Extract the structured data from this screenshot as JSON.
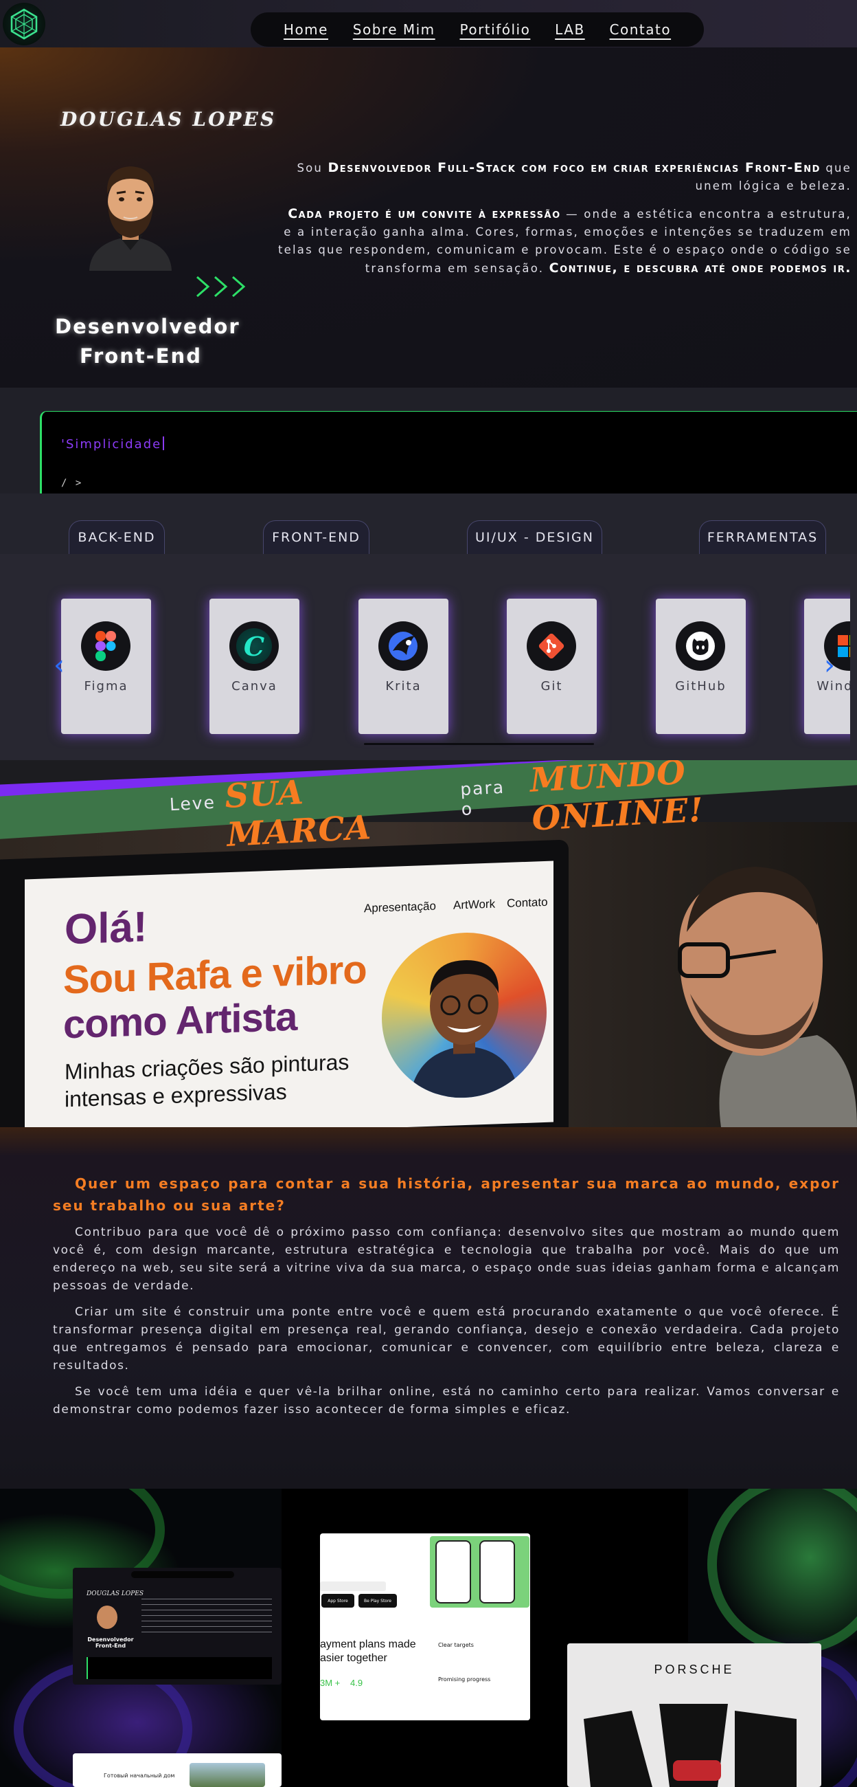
{
  "nav": {
    "items": [
      "Home",
      "Sobre Mim",
      "Portifólio",
      "LAB",
      "Contato"
    ]
  },
  "hero": {
    "name": "DOUGLAS LOPES",
    "role_line1": "Desenvolvedor",
    "role_line2": "Front-End",
    "p1_a": "Sou",
    "p1_strong": "Desenvolvedor Full-Stack com foco em criar experiências Front-End",
    "p1_b": "que unem lógica e beleza.",
    "p2_strong": "Cada projeto é um convite à expressão",
    "p2_a": "— onde a estética encontra a estrutura, e a interação ganha alma. Cores, formas, emoções e intenções se traduzem em telas que respondem, comunicam e provocam. Este é o espaço onde o código se transforma em sensação.",
    "p2_strong2": "Continue, e descubra até onde podemos ir."
  },
  "terminal": {
    "typed": "'Simplicidade",
    "prompt": "/ >"
  },
  "tabs": [
    "BACK-END",
    "FRONT-END",
    "UI/UX - DESIGN",
    "FERRAMENTAS"
  ],
  "tools": [
    {
      "label": "Figma",
      "icon": "figma-icon"
    },
    {
      "label": "Canva",
      "icon": "canva-icon"
    },
    {
      "label": "Krita",
      "icon": "krita-icon"
    },
    {
      "label": "Git",
      "icon": "git-icon"
    },
    {
      "label": "GitHub",
      "icon": "github-icon"
    },
    {
      "label": "Windows",
      "icon": "windows-icon"
    }
  ],
  "carousel": {
    "prev": "‹",
    "next": "›"
  },
  "banner": {
    "leve": "Leve",
    "sua_marca": "SUA MARCA",
    "para_o": "para o",
    "mundo_online": "MUNDO ONLINE!",
    "screen": {
      "nav": [
        "Apresentação",
        "ArtWork",
        "Contato"
      ],
      "ola": "Olá!",
      "line1": "Sou Rafa e vibro",
      "line2": "como Artista",
      "line3": "Minhas criações são pinturas intensas e expressivas"
    }
  },
  "about": {
    "question": "Quer um espaço para contar a sua história, apresentar sua marca ao mundo, expor seu trabalho ou sua arte?",
    "p1": "Contribuo para que você dê o próximo passo com confiança: desenvolvo sites que mostram ao mundo quem você é, com design marcante, estrutura estratégica e tecnologia que trabalha por você. Mais do que um endereço na web, seu site será a vitrine viva da sua marca, o espaço onde suas ideias ganham forma e alcançam pessoas de verdade.",
    "p2": "Criar um site é construir uma ponte entre você e quem está procurando exatamente o que você oferece. É transformar presença digital em presença real, gerando confiança, desejo e conexão verdadeira. Cada projeto que entregamos é pensado para emocionar, comunicar e convencer, com equilíbrio entre beleza, clareza e resultados.",
    "p3": "Se você tem uma idéia e quer vê-la brilhar online, está no caminho certo para realizar. Vamos conversar e demonstrar como podemos fazer isso acontecer de forma simples e eficaz."
  },
  "portfolio": {
    "thumb1": {
      "name": "DOUGLAS LOPES",
      "role": "Desenvolvedor Front-End"
    },
    "thumb2": {
      "title_a": "ayment plans made",
      "title_b": "asier together",
      "stat1": "3M +",
      "stat2": "4.9",
      "btn1": "App Store",
      "btn2": "Be Play Store",
      "feat1": "Clear targets",
      "feat2": "Promising progress"
    },
    "thumb3": {
      "brand": "PORSCHE"
    },
    "thumb4": {
      "caption": "Готовый начальный дом"
    }
  },
  "colors": {
    "accent_orange": "#f77c21",
    "accent_purple": "#7b2bf2",
    "accent_green": "#2ddf67",
    "tab_border": "#47466c"
  }
}
